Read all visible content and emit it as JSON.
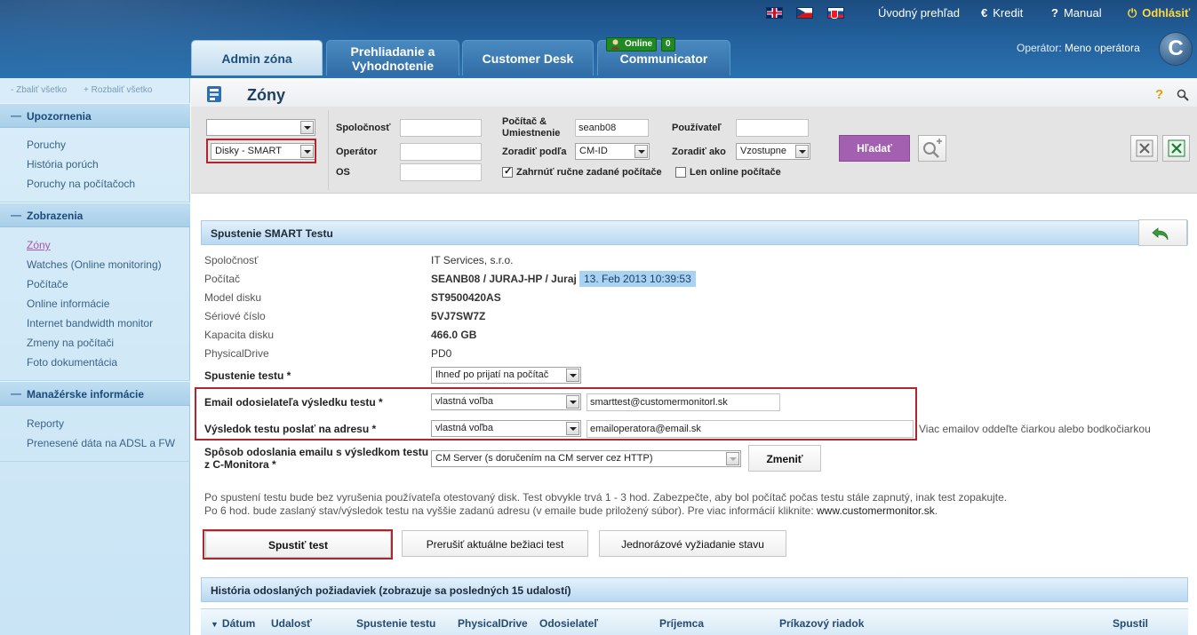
{
  "header": {
    "languages": [
      "English",
      "Čeština",
      "Slovenčina"
    ],
    "links": {
      "home": "Úvodný prehľad",
      "credit_icon": "€",
      "credit": "Kredit",
      "manual_icon": "?",
      "manual": "Manual",
      "logout_icon": "⏻",
      "logout": "Odhlásiť"
    },
    "tabs": [
      {
        "label": "Admin zóna",
        "active": true
      },
      {
        "label_line1": "Prehliadanie a",
        "label_line2": "Vyhodnotenie",
        "active": false
      },
      {
        "label": "Customer Desk",
        "active": false
      },
      {
        "label": "Communicator",
        "active": false
      }
    ],
    "online_label": "Online",
    "online_count": "0",
    "operator_label": "Operátor:",
    "operator_name": "Meno operátora",
    "brand_letter": "C"
  },
  "sidebar": {
    "collapse_all": "- Zbaliť všetko",
    "expand_all": "+ Rozbaliť všetko",
    "sections": [
      {
        "title": "Upozornenia",
        "items": [
          "Poruchy",
          "História porúch",
          "Poruchy na počítačoch"
        ]
      },
      {
        "title": "Zobrazenia",
        "items": [
          "Zóny",
          "Watches (Online monitoring)",
          "Počítače",
          "Online informácie",
          "Internet bandwidth monitor",
          "Zmeny na počítači",
          "Foto dokumentácia"
        ]
      },
      {
        "title": "Manažérske informácie",
        "items": [
          "Reporty",
          "Prenesené dáta na ADSL a FW"
        ]
      }
    ],
    "active_item": "Zóny"
  },
  "page": {
    "title": "Zóny",
    "help": "?"
  },
  "filters": {
    "zone_select": "",
    "view_select": "Disky - SMART",
    "company_label": "Spoločnosť",
    "company_value": "",
    "operator_label": "Operátor",
    "operator_value": "",
    "os_label": "OS",
    "os_value": "",
    "computer_label_1": "Počítač &",
    "computer_label_2": "Umiestnenie",
    "computer_value": "seanb08",
    "sort_label": "Zoradiť podľa",
    "sort_value": "CM-ID",
    "user_label": "Používateľ",
    "user_value": "",
    "sort_dir_label": "Zoradiť ako",
    "sort_dir_value": "Vzostupne",
    "include_manual_label": "Zahrnúť ručne zadané počítače",
    "include_manual_checked": true,
    "online_only_label": "Len online počítače",
    "online_only_checked": false,
    "search_button": "Hľadať"
  },
  "smart_test": {
    "section_title": "Spustenie SMART Testu",
    "rows": [
      {
        "label": "Spoločnosť",
        "value": "IT Services, s.r.o."
      },
      {
        "label": "Počítač",
        "value": "SEANB08 / JURAJ-HP / Juraj"
      },
      {
        "label": "Model disku",
        "value": "ST9500420AS"
      },
      {
        "label": "Sériové číslo",
        "value": "5VJ7SW7Z"
      },
      {
        "label": "Kapacita disku",
        "value": "466.0 GB"
      },
      {
        "label": "PhysicalDrive",
        "value": "PD0"
      }
    ],
    "timestamp": "13. Feb 2013 10:39:53",
    "start_label": "Spustenie testu *",
    "start_value": "Ihneď po prijatí na počítač",
    "sender_label": "Email odosielateľa výsledku testu *",
    "sender_mode": "vlastná voľba",
    "sender_email": "smarttest@customermonitorl.sk",
    "recipient_label": "Výsledok testu poslať na adresu *",
    "recipient_mode": "vlastná voľba",
    "recipient_email": "emailoperatora@email.sk",
    "recipient_hint": "Viac emailov oddeľte čiarkou alebo bodkočiarkou",
    "send_method_label_1": "Spôsob odoslania emailu s výsledkom testu",
    "send_method_label_2": "z C-Monitora *",
    "send_method_value": "CM Server (s doručením na CM server cez HTTP)",
    "change_button": "Zmeniť",
    "note_1": "Po spustení testu bude bez vyrušenia používateľa otestovaný disk. Test obvykle trvá 1 - 3 hod. Zabezpečte, aby bol počítač počas testu stále zapnutý, inak test zopakujte.",
    "note_2a": "Po 6 hod. bude zaslaný stav/výsledok testu na vyššie zadanú adresu (v emaile bude priložený súbor). Pre viac informácií kliknite: ",
    "note_2_link": "www.customermonitor.sk",
    "note_2b": ".",
    "run_button": "Spustiť test",
    "abort_button": "Prerušiť aktuálne bežiaci test",
    "status_button": "Jednorázové vyžiadanie stavu"
  },
  "history": {
    "title": "História odoslaných požiadaviek (zobrazuje sa posledných 15 udalostí)",
    "columns": [
      "Dátum",
      "Udalosť",
      "Spustenie testu",
      "PhysicalDrive",
      "Odosielateľ",
      "Príjemca",
      "Príkazový riadok",
      "Spustil"
    ]
  },
  "colors": {
    "header_blue": "#225f9a",
    "accent_purple": "#a35fb0",
    "highlight_red": "#b0262d",
    "timestamp_blue": "#a9d3f2"
  }
}
